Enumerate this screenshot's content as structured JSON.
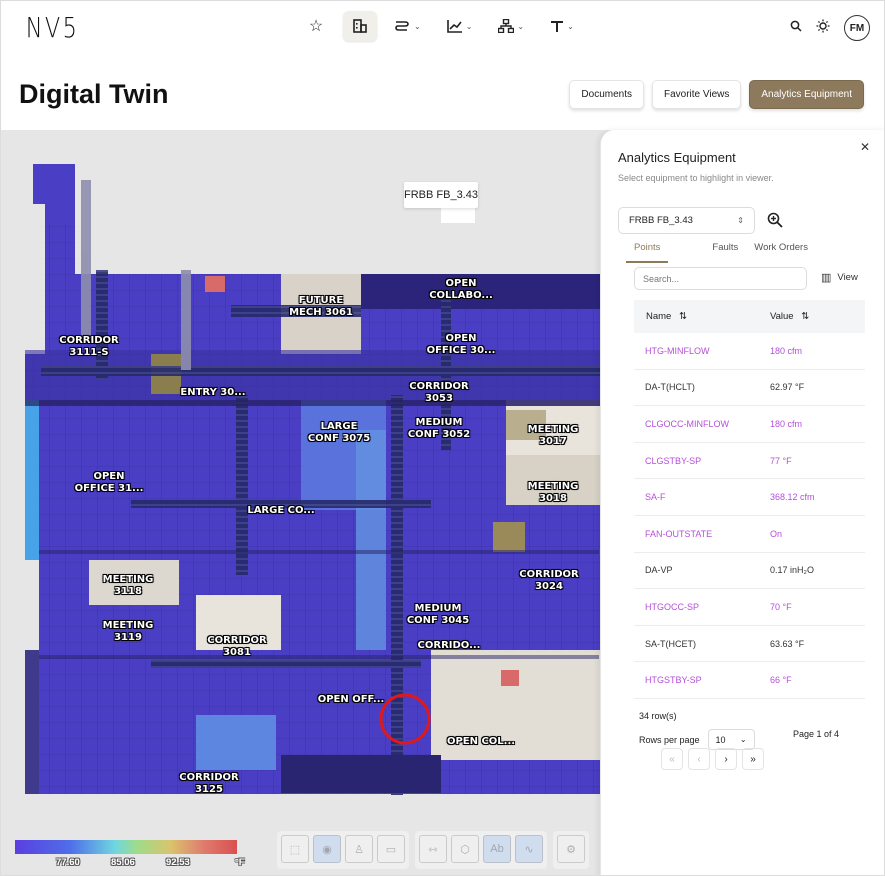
{
  "app": {
    "logo": "NV5",
    "avatar_initials": "FM"
  },
  "nav": {
    "items": [
      {
        "icon": "star-icon",
        "caret": false,
        "active": false
      },
      {
        "icon": "building-icon",
        "caret": false,
        "active": true
      },
      {
        "icon": "flow-icon",
        "caret": true,
        "active": false
      },
      {
        "icon": "chart-icon",
        "caret": true,
        "active": false
      },
      {
        "icon": "hierarchy-icon",
        "caret": true,
        "active": false
      },
      {
        "icon": "tools-icon",
        "caret": true,
        "active": false
      }
    ]
  },
  "header": {
    "title": "Digital Twin",
    "buttons": {
      "documents": "Documents",
      "favorite_views": "Favorite Views",
      "analytics_equipment": "Analytics Equipment"
    }
  },
  "viewer": {
    "tooltip": "FRBB FB_3.43",
    "rooms": [
      "CORRIDOR\n3111-S",
      "FUTURE\nMECH 3061",
      "OPEN\nCOLLABO...",
      "OPEN\nOFFICE 30...",
      "ENTRY 30...",
      "CORRIDOR\n3053",
      "LARGE\nCONF 3075",
      "MEDIUM\nCONF 3052",
      "MEETING\n3017",
      "OPEN\nOFFICE 31...",
      "LARGE CO...",
      "MEETING\n3018",
      "MEETING\n3118",
      "CORRIDOR\n3024",
      "MEETING\n3119",
      "MEDIUM\nCONF 3045",
      "CORRIDOR\n3081",
      "CORRIDO...",
      "OPEN OFF...",
      "OPEN COL...",
      "CORRIDOR\n3125"
    ],
    "legend": {
      "ticks": [
        "77.60",
        "85.06",
        "92.53",
        "°F"
      ]
    }
  },
  "panel": {
    "title": "Analytics Equipment",
    "subtitle": "Select equipment to highlight in viewer.",
    "selected_equipment": "FRBB FB_3.43",
    "tabs": [
      "Points",
      "Faults",
      "Work Orders"
    ],
    "search_placeholder": "Search...",
    "view_label": "View",
    "columns": {
      "name": "Name",
      "value": "Value"
    },
    "rows": [
      {
        "name": "HTG-MINFLOW",
        "value": "180 cfm",
        "highlight": true
      },
      {
        "name": "DA-T(HCLT)",
        "value": "62.97 °F",
        "highlight": false
      },
      {
        "name": "CLGOCC-MINFLOW",
        "value": "180 cfm",
        "highlight": true
      },
      {
        "name": "CLGSTBY-SP",
        "value": "77 °F",
        "highlight": true
      },
      {
        "name": "SA-F",
        "value": "368.12 cfm",
        "highlight": true
      },
      {
        "name": "FAN-OUTSTATE",
        "value": "On",
        "highlight": true
      },
      {
        "name": "DA-VP",
        "value": "0.17 inH₂O",
        "highlight": false
      },
      {
        "name": "HTGOCC-SP",
        "value": "70 °F",
        "highlight": true
      },
      {
        "name": "SA-T(HCET)",
        "value": "63.63 °F",
        "highlight": false
      },
      {
        "name": "HTGSTBY-SP",
        "value": "66 °F",
        "highlight": true
      }
    ],
    "row_count": "34 row(s)",
    "rows_per_page_label": "Rows per page",
    "rows_per_page": "10",
    "page_info": "Page 1 of 4"
  },
  "colors": {
    "accent": "#8d7a5c",
    "highlight_text": "#b44fd9",
    "floor_blue": "#4a3fc4"
  }
}
